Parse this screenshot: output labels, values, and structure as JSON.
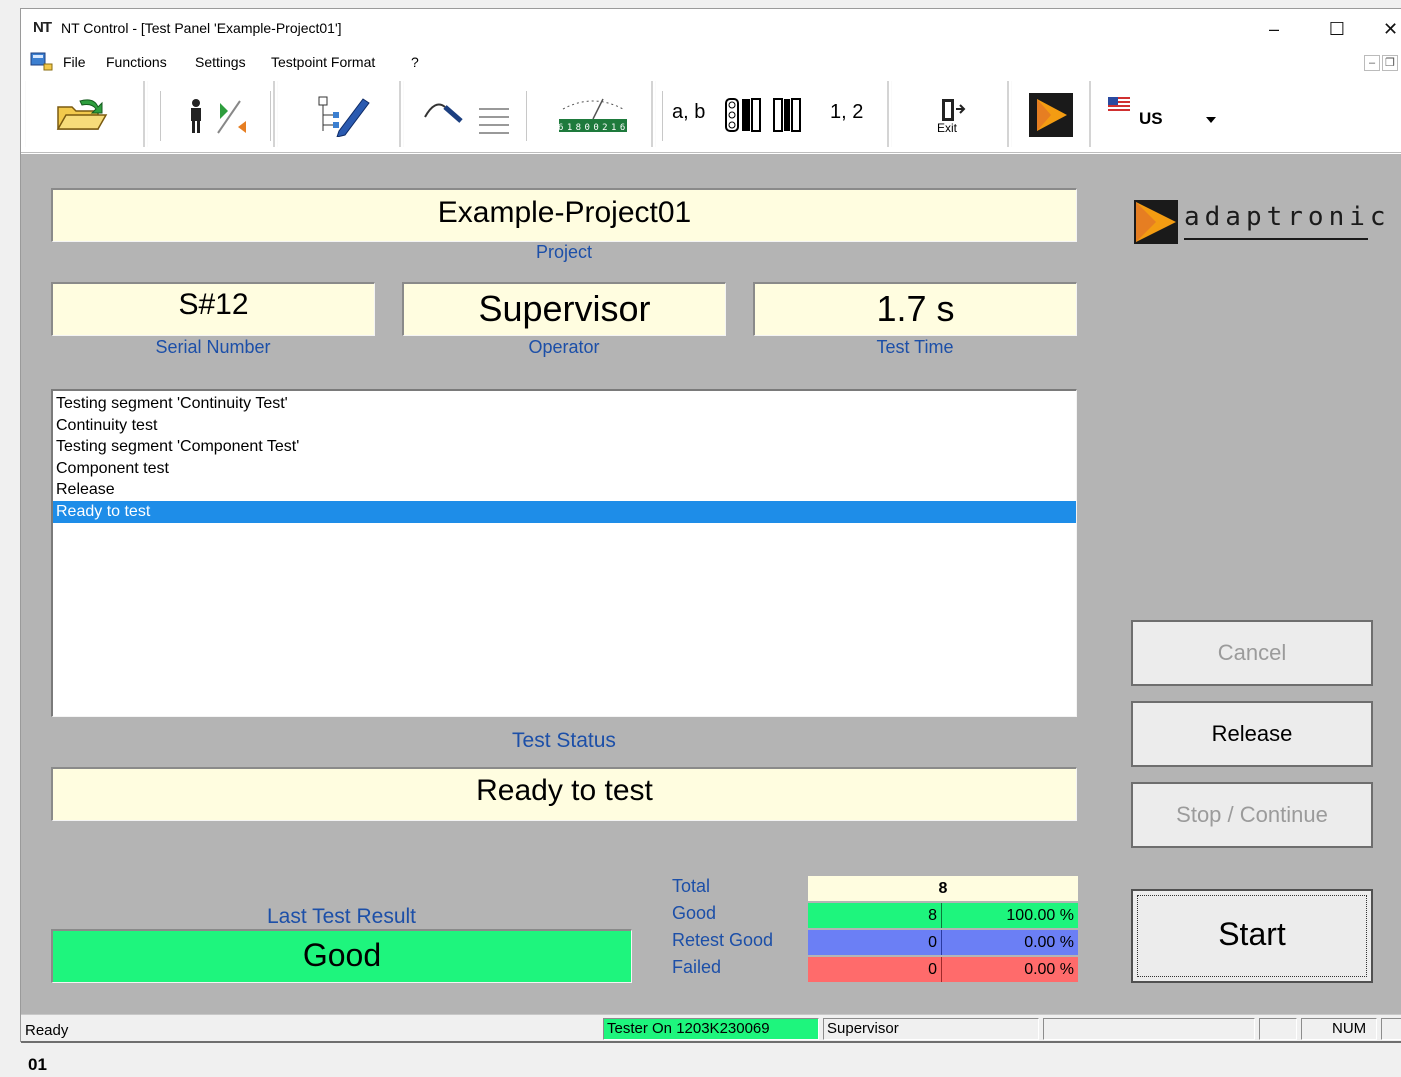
{
  "window": {
    "app_icon": "NT",
    "title": "NT Control - [Test Panel 'Example-Project01']",
    "minimize": "–",
    "maximize": "☐",
    "close": "✕"
  },
  "menu": {
    "items": [
      "File",
      "Functions",
      "Settings",
      "Testpoint Format",
      "?"
    ],
    "mdi_minimize": "–",
    "mdi_restore": "❐"
  },
  "toolbar": {
    "abc_label": "a, b",
    "num_label": "1, 2",
    "counter_digits": "6 1 8 0 0 2 1 6",
    "exit_label": "Exit",
    "language": "US",
    "flag_icon": "us-flag-icon"
  },
  "panel": {
    "project_value": "Example-Project01",
    "project_caption": "Project",
    "serial_value": "S#12",
    "serial_caption": "Serial Number",
    "operator_value": "Supervisor",
    "operator_caption": "Operator",
    "time_value": "1.7 s",
    "time_caption": "Test Time",
    "log_lines": [
      "Testing segment 'Continuity Test'",
      "Continuity test",
      "Testing segment 'Component Test'",
      "Component test",
      "Release",
      "Ready to test"
    ],
    "selected_log_index": 5,
    "status_caption": "Test Status",
    "status_value": "Ready to test",
    "last_result_caption": "Last Test Result",
    "last_result_value": "Good",
    "logo_text": "adaptronic",
    "buttons": {
      "cancel": "Cancel",
      "release": "Release",
      "stop_continue": "Stop / Continue",
      "start": "Start"
    }
  },
  "stats": {
    "total_label": "Total",
    "total_value": "8",
    "good_label": "Good",
    "good_count": "8",
    "good_pct": "100.00 %",
    "retest_label": "Retest Good",
    "retest_count": "0",
    "retest_pct": "0.00 %",
    "failed_label": "Failed",
    "failed_count": "0",
    "failed_pct": "0.00 %"
  },
  "colors": {
    "panel_bg": "#b4b4b4",
    "field_bg": "#fffde0",
    "caption": "#1c4fa8",
    "good": "#1ef57d",
    "retest": "#6b7ff5",
    "failed": "#ff6b6b",
    "selection": "#1e8de8",
    "tester_on": "#1ef57d"
  },
  "statusbar": {
    "ready": "Ready",
    "tester": "Tester On 1203K230069",
    "user": "Supervisor",
    "num": "NUM"
  },
  "figure_label": "01"
}
